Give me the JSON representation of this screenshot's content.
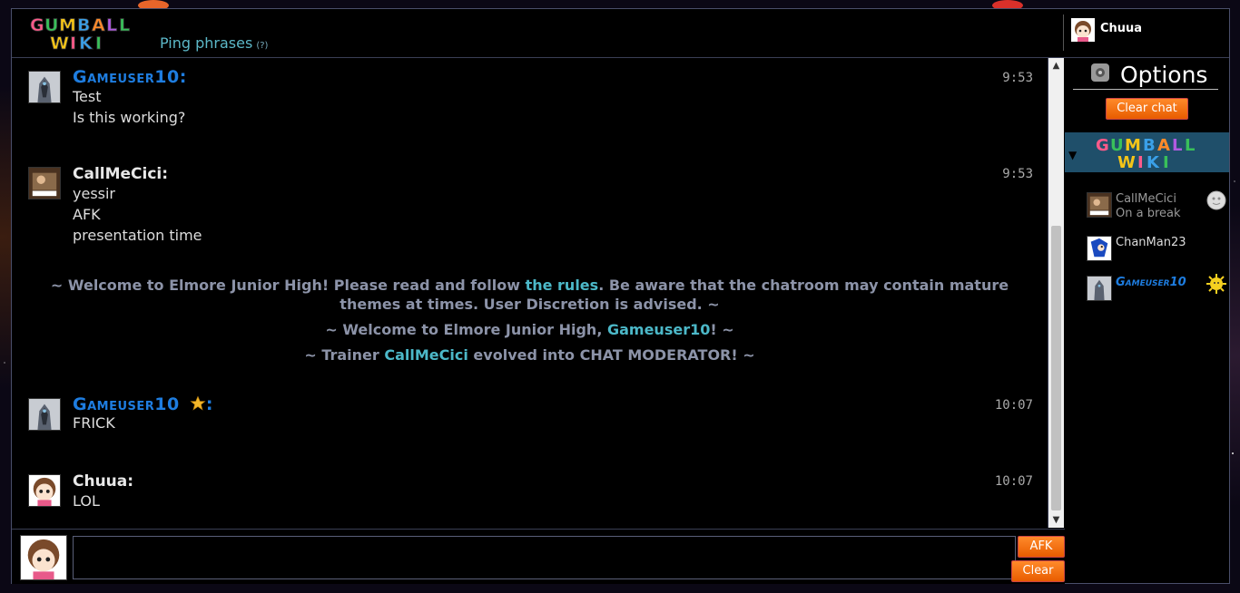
{
  "header": {
    "logo_text": "GUMBALL WIKI",
    "ping_phrases": "Ping phrases",
    "ping_help": "(?)",
    "current_user": "Chuua"
  },
  "messages": [
    {
      "user": "Gameuser10:",
      "time": "9:53",
      "lines": [
        "Test",
        "Is this working?"
      ],
      "moderator": true,
      "star": false
    },
    {
      "user": "CallMeCici:",
      "time": "9:53",
      "lines": [
        "yessir",
        "AFK",
        "presentation time"
      ],
      "moderator": false,
      "star": false
    },
    {
      "user": "Gameuser10",
      "time": "10:07",
      "lines": [
        "FRICK"
      ],
      "moderator": true,
      "star": true
    },
    {
      "user": "Chuua:",
      "time": "10:07",
      "lines": [
        "LOL"
      ],
      "moderator": false,
      "star": false
    }
  ],
  "inline_alerts": {
    "welcome_part1": "~ Welcome to Elmore Junior High! Please read and follow ",
    "welcome_link": "the rules",
    "welcome_part2": ". Be aware that the chatroom may contain mature",
    "welcome_line2": "themes at times. User Discretion is advised. ~",
    "join_part1": "~ Welcome to Elmore Junior High, ",
    "join_user": "Gameuser10",
    "join_part2": "! ~",
    "evolve_part1": "~ Trainer ",
    "evolve_user": "CallMeCici",
    "evolve_part2": " evolved into CHAT MODERATOR! ~"
  },
  "star_colon": ":",
  "sidebar": {
    "options_title": "Options",
    "clear_chat_label": "Clear chat",
    "room_logo_text": "GUMBALL WIKI",
    "users": [
      {
        "name": "CallMeCici",
        "status": "On a break",
        "away": true
      },
      {
        "name": "ChanMan23",
        "status": "",
        "away": false
      },
      {
        "name": "Gameuser10",
        "status": "",
        "away": false,
        "moderator": true
      }
    ]
  },
  "input": {
    "value": "",
    "afk_label": "AFK",
    "clear_label": "Clear"
  },
  "colors": {
    "moderator_name": "#1e7de0",
    "link": "#4cb8c8",
    "button_orange": "#ff8a2a"
  }
}
